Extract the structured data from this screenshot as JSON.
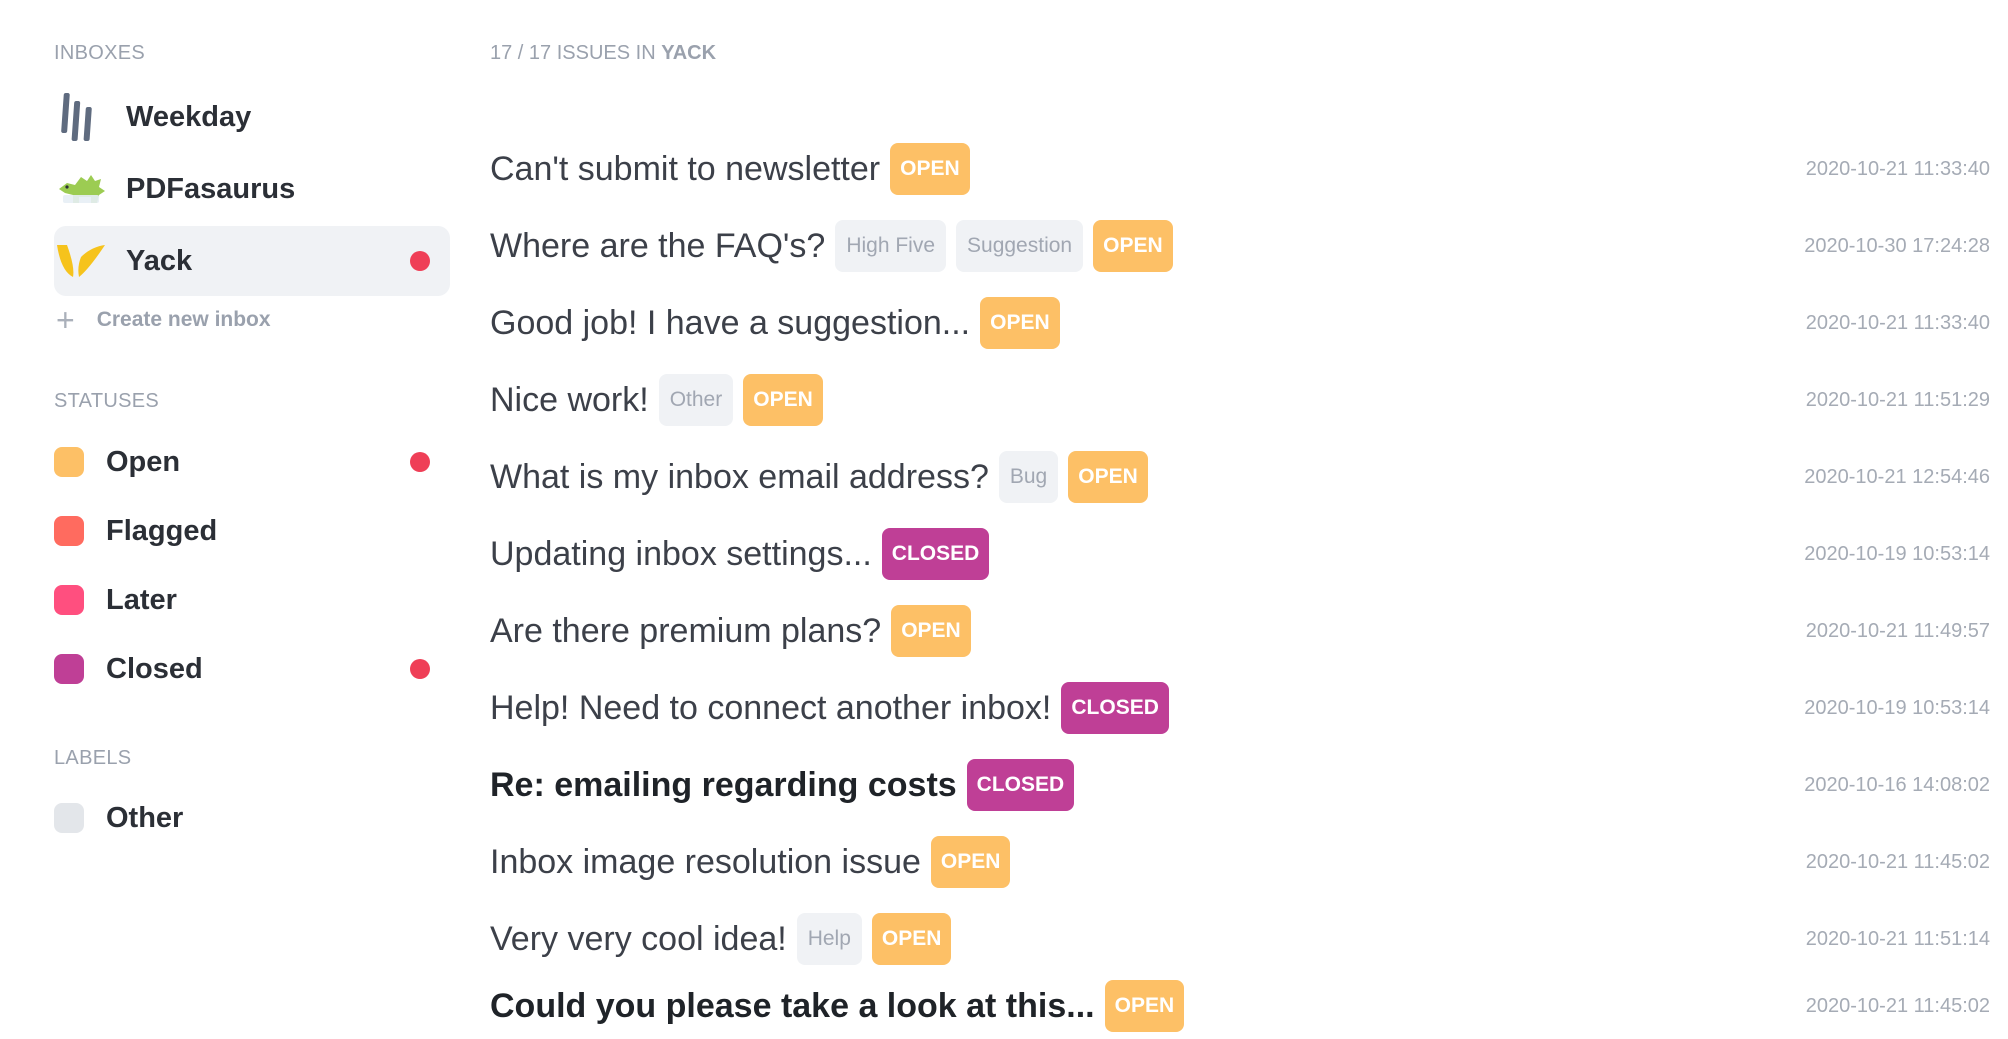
{
  "sidebar": {
    "inboxes_heading": "INBOXES",
    "inboxes": [
      {
        "label": "Weekday",
        "icon": "weekday-logo-icon",
        "active": false,
        "unread": false
      },
      {
        "label": "PDFasaurus",
        "icon": "dinosaur-logo-icon",
        "active": false,
        "unread": false
      },
      {
        "label": "Yack",
        "icon": "yack-logo-icon",
        "active": true,
        "unread": true
      }
    ],
    "create_inbox_label": "Create new inbox",
    "statuses_heading": "STATUSES",
    "statuses": [
      {
        "label": "Open",
        "color": "#fdc066",
        "unread": true
      },
      {
        "label": "Flagged",
        "color": "#ff6b5f",
        "unread": false
      },
      {
        "label": "Later",
        "color": "#ff4f7f",
        "unread": false
      },
      {
        "label": "Closed",
        "color": "#bf3f96",
        "unread": true
      }
    ],
    "labels_heading": "LABELS",
    "labels": [
      {
        "label": "Other",
        "color": "#e3e6ea"
      }
    ]
  },
  "main": {
    "count_prefix": "17 / 17 ISSUES IN",
    "count_inbox": "YACK",
    "issues": [
      {
        "title": "Can't submit to newsletter",
        "bold": false,
        "labels": [],
        "status": "OPEN",
        "date": "2020-10-21 11:33:40"
      },
      {
        "title": "Where are the FAQ's?",
        "bold": false,
        "labels": [
          "High Five",
          "Suggestion"
        ],
        "status": "OPEN",
        "date": "2020-10-30 17:24:28"
      },
      {
        "title": "Good job! I have a suggestion...",
        "bold": false,
        "labels": [],
        "status": "OPEN",
        "date": "2020-10-21 11:33:40"
      },
      {
        "title": "Nice work!",
        "bold": false,
        "labels": [
          "Other"
        ],
        "status": "OPEN",
        "date": "2020-10-21 11:51:29"
      },
      {
        "title": "What is my inbox email address?",
        "bold": false,
        "labels": [
          "Bug"
        ],
        "status": "OPEN",
        "date": "2020-10-21 12:54:46"
      },
      {
        "title": "Updating inbox settings...",
        "bold": false,
        "labels": [],
        "status": "CLOSED",
        "date": "2020-10-19 10:53:14"
      },
      {
        "title": "Are there premium plans?",
        "bold": false,
        "labels": [],
        "status": "OPEN",
        "date": "2020-10-21 11:49:57"
      },
      {
        "title": "Help! Need to connect another inbox!",
        "bold": false,
        "labels": [],
        "status": "CLOSED",
        "date": "2020-10-19 10:53:14"
      },
      {
        "title": "Re: emailing regarding costs",
        "bold": true,
        "labels": [],
        "status": "CLOSED",
        "date": "2020-10-16 14:08:02"
      },
      {
        "title": "Inbox image resolution issue",
        "bold": false,
        "labels": [],
        "status": "OPEN",
        "date": "2020-10-21 11:45:02"
      },
      {
        "title": "Very very cool idea!",
        "bold": false,
        "labels": [
          "Help"
        ],
        "status": "OPEN",
        "date": "2020-10-21 11:51:14"
      },
      {
        "title": "Could you please take a look at this...",
        "bold": true,
        "labels": [],
        "status": "OPEN",
        "date": "2020-10-21 11:45:02"
      }
    ]
  }
}
